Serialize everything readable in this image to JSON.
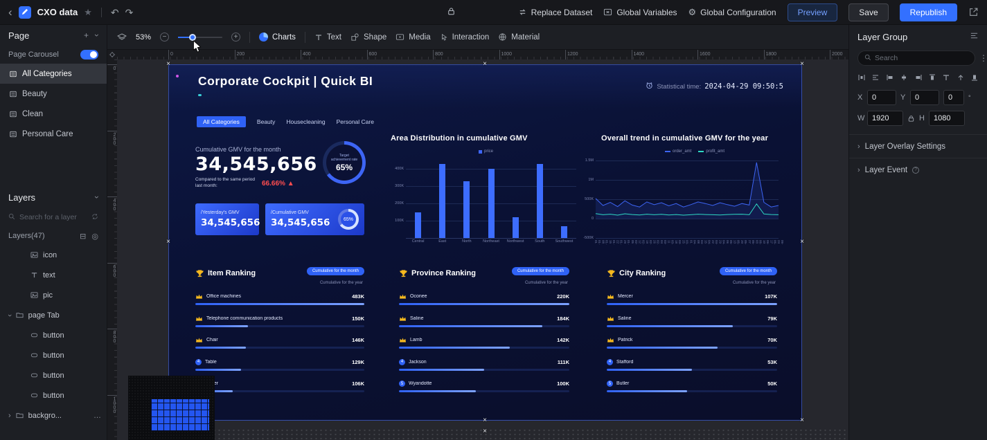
{
  "topbar": {
    "app_title": "CXO data",
    "actions": {
      "replace_dataset": "Replace Dataset",
      "global_variables": "Global Variables",
      "global_configuration": "Global Configuration",
      "preview": "Preview",
      "save": "Save",
      "republish": "Republish"
    }
  },
  "toolbar": {
    "zoom_percent": "53%",
    "menu": [
      "Charts",
      "Text",
      "Shape",
      "Media",
      "Interaction",
      "Material"
    ]
  },
  "rulers": {
    "horizontal": [
      "0",
      "200",
      "400",
      "600",
      "800",
      "1000",
      "1200",
      "1400",
      "1600",
      "1800",
      "2000"
    ],
    "vertical": [
      "0",
      "200",
      "400",
      "600",
      "800",
      "1000"
    ]
  },
  "left_panel": {
    "page": {
      "title": "Page",
      "carousel_label": "Page Carousel",
      "carousel_on": true,
      "categories": [
        {
          "label": "All Categories",
          "active": true
        },
        {
          "label": "Beauty",
          "active": false
        },
        {
          "label": "Clean",
          "active": false
        },
        {
          "label": "Personal Care",
          "active": false
        }
      ]
    },
    "layers": {
      "title": "Layers",
      "search_placeholder": "Search for a layer",
      "count_label": "Layers(47)",
      "items": [
        {
          "label": "icon",
          "icon": "image",
          "indent": 2
        },
        {
          "label": "text",
          "icon": "text",
          "indent": 2
        },
        {
          "label": "pic",
          "icon": "image",
          "indent": 2
        },
        {
          "label": "page Tab",
          "icon": "folder",
          "indent": 1,
          "expanded": true
        },
        {
          "label": "button",
          "icon": "widget",
          "indent": 2
        },
        {
          "label": "button",
          "icon": "widget",
          "indent": 2
        },
        {
          "label": "button",
          "icon": "widget",
          "indent": 2
        },
        {
          "label": "button",
          "icon": "widget",
          "indent": 2
        },
        {
          "label": "backgro...",
          "icon": "folder",
          "indent": 1,
          "expanded": false,
          "more": true
        }
      ]
    }
  },
  "right_panel": {
    "title": "Layer Group",
    "search_placeholder": "Search",
    "align_icons": [
      "distribute-horizontal",
      "align-justify",
      "align-left",
      "align-center-horizontal",
      "align-right",
      "align-top",
      "text-align",
      "move-up",
      "align-bottom"
    ],
    "position": {
      "x_label": "X",
      "x_value": "0",
      "y_label": "Y",
      "y_value": "0",
      "rotation_value": "0",
      "rotation_unit": "°"
    },
    "size": {
      "w_label": "W",
      "w_value": "1920",
      "h_label": "H",
      "h_value": "1080"
    },
    "sections": [
      {
        "label": "Layer Overlay Settings",
        "info": false
      },
      {
        "label": "Layer Event",
        "info": true
      }
    ]
  },
  "dashboard": {
    "title": "Corporate Cockpit | Quick BI",
    "stat_time_label": "Statistical time:",
    "stat_time_value": "2024-04-29 09:50:5",
    "tabs": [
      {
        "label": "All Categories",
        "active": true
      },
      {
        "label": "Beauty",
        "active": false
      },
      {
        "label": "Housecleaning",
        "active": false
      },
      {
        "label": "Personal Care",
        "active": false
      }
    ],
    "kpi": {
      "label": "Cumulative GMV for the month",
      "value": "34,545,656",
      "compare_label": "Compared to the same period last month:",
      "compare_value": "66.66% ▲",
      "gauge_label": "Target achievement rate",
      "gauge_value": "65%"
    },
    "cards": [
      {
        "label": "/Yesterday's GMV",
        "value": "34,545,656"
      },
      {
        "label": "/Cumulative GMV",
        "value": "34,545,656",
        "donut": "65%"
      }
    ],
    "rankings": [
      {
        "title": "Item Ranking",
        "pill": "Cumulative for the month",
        "sub": "Cumulative for the year",
        "rows": [
          {
            "rank": 1,
            "name": "Office machines",
            "value": "483K",
            "pct": 100
          },
          {
            "rank": 2,
            "name": "Telephone communication products",
            "value": "150K",
            "pct": 31
          },
          {
            "rank": 3,
            "name": "Chair",
            "value": "146K",
            "pct": 30
          },
          {
            "rank": 4,
            "name": "Table",
            "value": "129K",
            "pct": 27
          },
          {
            "rank": 5,
            "name": "copier",
            "value": "106K",
            "pct": 22
          }
        ]
      },
      {
        "title": "Province Ranking",
        "pill": "Cumulative for the month",
        "sub": "Cumulative for the year",
        "rows": [
          {
            "rank": 1,
            "name": "Oconee",
            "value": "220K",
            "pct": 100
          },
          {
            "rank": 2,
            "name": "Saline",
            "value": "184K",
            "pct": 84
          },
          {
            "rank": 3,
            "name": "Lamb",
            "value": "142K",
            "pct": 65
          },
          {
            "rank": 4,
            "name": "Jackson",
            "value": "111K",
            "pct": 50
          },
          {
            "rank": 5,
            "name": "Wyandotte",
            "value": "100K",
            "pct": 45
          }
        ]
      },
      {
        "title": "City Ranking",
        "pill": "Cumulative for the month",
        "sub": "Cumulative for the year",
        "rows": [
          {
            "rank": 1,
            "name": "Mercer",
            "value": "107K",
            "pct": 100
          },
          {
            "rank": 2,
            "name": "Saline",
            "value": "79K",
            "pct": 74
          },
          {
            "rank": 3,
            "name": "Patrick",
            "value": "70K",
            "pct": 65
          },
          {
            "rank": 4,
            "name": "Stafford",
            "value": "53K",
            "pct": 50
          },
          {
            "rank": 5,
            "name": "Butler",
            "value": "50K",
            "pct": 47
          }
        ]
      }
    ]
  },
  "chart_data": [
    {
      "type": "bar",
      "title": "Area Distribution in cumulative GMV",
      "legend": [
        "price"
      ],
      "categories": [
        "Central",
        "East",
        "North",
        "Northeast",
        "Northwest",
        "South",
        "Southwest"
      ],
      "values": [
        150,
        430,
        330,
        400,
        120,
        430,
        70
      ],
      "unit": "K",
      "ylabel": "",
      "yticks": [
        400,
        300,
        200,
        100
      ],
      "ytick_labels": [
        "400K",
        "300K",
        "200K",
        "100K"
      ],
      "ylim": [
        0,
        450
      ],
      "bar_color": "#3d6dff"
    },
    {
      "type": "line",
      "title": "Overall trend in cumulative GMV for the year",
      "legend": [
        "order_amt",
        "profit_amt"
      ],
      "x": [
        "01-01",
        "01-08",
        "01-15",
        "01-22",
        "01-29",
        "02-05",
        "02-12",
        "02-19",
        "02-26",
        "03-04",
        "03-11",
        "03-18",
        "03-25",
        "04-01",
        "04-08",
        "04-15",
        "04-22",
        "04-29",
        "05-06",
        "05-13",
        "05-20",
        "05-27",
        "06-03",
        "06-10",
        "06-17",
        "06-24"
      ],
      "series": [
        {
          "name": "order_amt",
          "color": "#3d65f5",
          "values": [
            520,
            340,
            420,
            310,
            460,
            350,
            300,
            430,
            360,
            410,
            330,
            390,
            300,
            360,
            430,
            390,
            340,
            410,
            360,
            320,
            390,
            350,
            1450,
            420,
            300,
            340
          ]
        },
        {
          "name": "profit_amt",
          "color": "#2ed9c3",
          "values": [
            130,
            100,
            115,
            90,
            125,
            105,
            95,
            115,
            100,
            110,
            95,
            105,
            90,
            100,
            115,
            105,
            100,
            95,
            105,
            110,
            115,
            100,
            380,
            120,
            105,
            100
          ]
        }
      ],
      "unit": "K",
      "yticks": [
        1500,
        1000,
        500,
        0,
        -500
      ],
      "ytick_labels": [
        "1.5M",
        "1M",
        "500K",
        "0",
        "-500K"
      ],
      "ylim": [
        -500,
        1500
      ]
    }
  ]
}
